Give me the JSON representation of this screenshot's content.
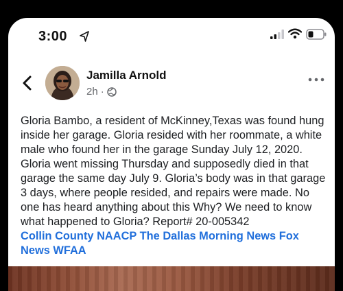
{
  "status_bar": {
    "time": "3:00"
  },
  "post": {
    "author": "Jamilla Arnold",
    "time_ago": "2h",
    "separator": "·",
    "text": "Gloria Bambo, a resident of McKinney,Texas was found hung inside her garage. Gloria resided with her roommate, a white male who found her in the garage Sunday July 12, 2020. Gloria went missing Thursday and supposedly died in that garage the same day July 9. Gloria’s body was in that garage 3 days, where people resided, and repairs were made. No one has heard anything about this Why? We need to know what happened to Gloria? Report# 20-005342",
    "tags": [
      "Collin County NAACP",
      "The Dallas Morning News",
      "Fox News",
      "WFAA"
    ]
  },
  "icons": {
    "back": "chevron-left-icon",
    "more": "more-dots-icon",
    "globe": "globe-icon",
    "location": "location-arrow-icon",
    "signal": "cell-signal-icon",
    "wifi": "wifi-icon",
    "battery": "battery-icon"
  },
  "colors": {
    "link": "#216fdb",
    "meta": "#65676b",
    "text": "#1c1e21"
  }
}
